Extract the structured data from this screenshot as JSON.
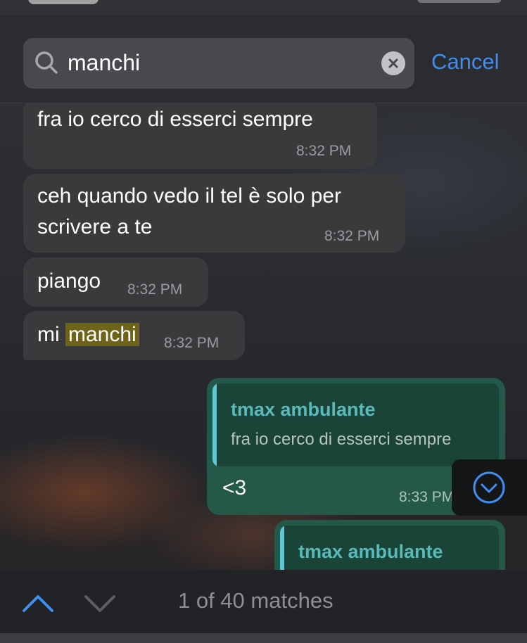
{
  "search": {
    "query": "manchi",
    "cancel_label": "Cancel"
  },
  "messages": [
    {
      "text": "fra io cerco di esserci sempre",
      "time": "8:32 PM"
    },
    {
      "line1": "ceh quando vedo il tel è solo per",
      "line2": "scrivere a te",
      "time": "8:32 PM"
    },
    {
      "text": "piango",
      "time": "8:32 PM"
    },
    {
      "prefix": "mi",
      "match": "manchi",
      "time": "8:32 PM"
    }
  ],
  "outgoing": [
    {
      "reply_name": "tmax ambulante",
      "reply_text": "fra io cerco di esserci sempre",
      "text": "<3",
      "time": "8:33 PM"
    },
    {
      "reply_name": "tmax ambulante"
    }
  ],
  "navigation": {
    "match_status": "1 of 40 matches"
  },
  "colors": {
    "accent": "#3f8ef2",
    "outgoing_bubble": "#245949",
    "incoming_bubble": "#3a3a3d",
    "match_highlight": "#6e6318"
  }
}
